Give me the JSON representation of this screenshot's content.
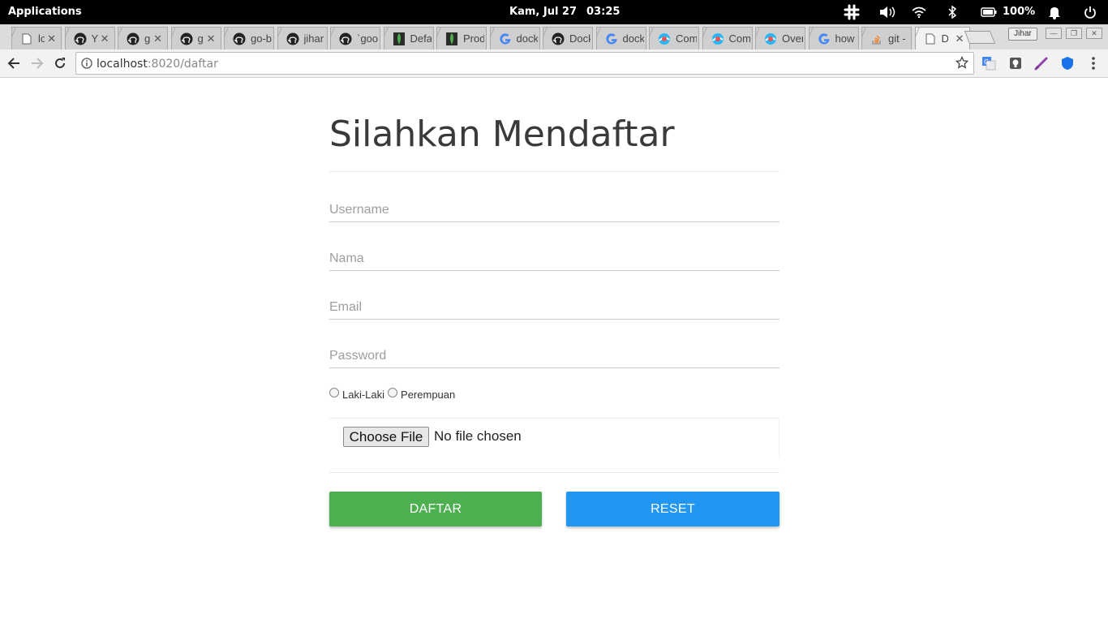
{
  "os_bar": {
    "apps_label": "Applications",
    "date": "Kam, Jul 27",
    "time": "03:25",
    "battery_percent": "100%",
    "tray_icons": [
      "slack-icon",
      "volume-icon",
      "wifi-icon",
      "bluetooth-icon",
      "battery-icon",
      "bell-icon",
      "power-icon"
    ]
  },
  "tabs": [
    {
      "title": "lo",
      "icon": "page-icon"
    },
    {
      "title": "Y",
      "icon": "github-icon"
    },
    {
      "title": "g",
      "icon": "github-icon"
    },
    {
      "title": "g",
      "icon": "github-icon"
    },
    {
      "title": "go-b",
      "icon": "github-icon"
    },
    {
      "title": "jihar",
      "icon": "github-icon"
    },
    {
      "title": "`goo",
      "icon": "github-icon"
    },
    {
      "title": "Defa",
      "icon": "mongodb-icon"
    },
    {
      "title": "Prod",
      "icon": "mongodb-icon"
    },
    {
      "title": "dock",
      "icon": "google-icon"
    },
    {
      "title": "Dock",
      "icon": "github-icon"
    },
    {
      "title": "dock",
      "icon": "google-icon"
    },
    {
      "title": "Com",
      "icon": "browser-icon"
    },
    {
      "title": "Com",
      "icon": "browser-icon"
    },
    {
      "title": "Over",
      "icon": "browser-icon"
    },
    {
      "title": "how",
      "icon": "google-icon"
    },
    {
      "title": "git -",
      "icon": "stackoverflow-icon"
    },
    {
      "title": "D",
      "icon": "page-icon",
      "active": true
    }
  ],
  "profile_name": "Jihar",
  "address_bar": {
    "host": "localhost",
    "port_path": ":8020/daftar"
  },
  "page": {
    "title": "Silahkan Mendaftar",
    "username_placeholder": "Username",
    "nama_placeholder": "Nama",
    "email_placeholder": "Email",
    "password_placeholder": "Password",
    "gender_options": [
      "Laki-Laki",
      "Perempuan"
    ],
    "file_button_label": "Choose File",
    "file_status": "No file chosen",
    "daftar_label": "DAFTAR",
    "reset_label": "RESET"
  },
  "colors": {
    "daftar_button": "#4caf50",
    "reset_button": "#2196f3",
    "os_bar": "#000000"
  }
}
